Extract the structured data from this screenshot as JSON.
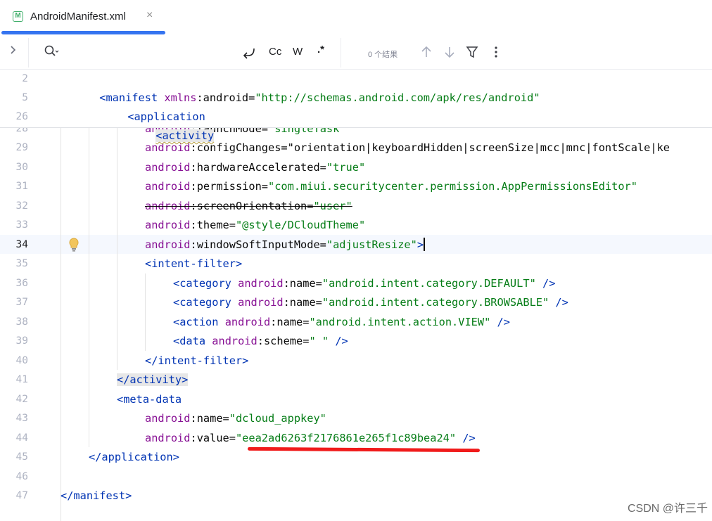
{
  "tab": {
    "file_icon_letter": "M",
    "label": "AndroidManifest.xml",
    "close_glyph": "×"
  },
  "search": {
    "tools": {
      "regex_toggle": ".*",
      "match_case": "Cc",
      "whole_word": "W"
    },
    "result_count": "0 个结果"
  },
  "colors": {
    "tab_accent": "#3574f0",
    "annotation_red": "#f01b1b",
    "tag": "#0033b3",
    "namespace": "#871094",
    "attribute": "#174ad4",
    "value": "#067d17"
  },
  "sticky_lines": [
    {
      "num": "2",
      "text": "<manifest xmlns:android=\"http://schemas.android.com/apk/res/android\""
    },
    {
      "num": "5",
      "text": "<application"
    },
    {
      "num": "26",
      "text": "<activity"
    }
  ],
  "partial_line": {
    "num": "28",
    "text": "android:launchMode=\"singleTask\""
  },
  "lines": [
    {
      "num": "29",
      "text": "android:configChanges=\"orientation|keyboardHidden|screenSize|mcc|mnc|fontScale|ke"
    },
    {
      "num": "30",
      "text": "android:hardwareAccelerated=\"true\""
    },
    {
      "num": "31",
      "text": "android:permission=\"com.miui.securitycenter.permission.AppPermissionsEditor\""
    },
    {
      "num": "32",
      "text": "android:screenOrientation=\"user\""
    },
    {
      "num": "33",
      "text": "android:theme=\"@style/DCloudTheme\""
    },
    {
      "num": "34",
      "text": "android:windowSoftInputMode=\"adjustResize\">"
    },
    {
      "num": "35",
      "text": "<intent-filter>"
    },
    {
      "num": "36",
      "text": "<category android:name=\"android.intent.category.DEFAULT\" />"
    },
    {
      "num": "37",
      "text": "<category android:name=\"android.intent.category.BROWSABLE\" />"
    },
    {
      "num": "38",
      "text": "<action android:name=\"android.intent.action.VIEW\" />"
    },
    {
      "num": "39",
      "text": "<data android:scheme=\" \" />"
    },
    {
      "num": "40",
      "text": "</intent-filter>"
    },
    {
      "num": "41",
      "text": "</activity>"
    },
    {
      "num": "42",
      "text": "<meta-data"
    },
    {
      "num": "43",
      "text": "android:name=\"dcloud_appkey\""
    },
    {
      "num": "44",
      "text": "android:value=\"eea2ad6263f2176861e265f1c89bea24\" />"
    },
    {
      "num": "45",
      "text": "</application>"
    },
    {
      "num": "46",
      "text": ""
    },
    {
      "num": "47",
      "text": "</manifest>"
    }
  ],
  "current_line": "34",
  "watermark": "CSDN @许三千"
}
